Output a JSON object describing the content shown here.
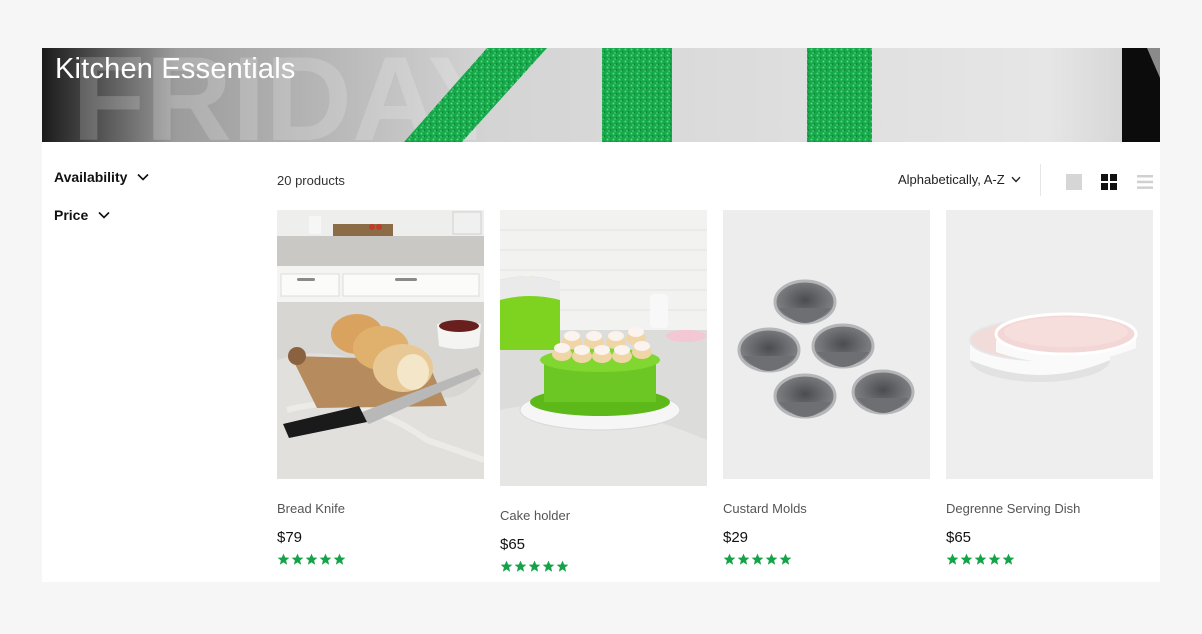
{
  "collection": {
    "title": "Kitchen Essentials",
    "product_count": "20 products"
  },
  "filters": [
    {
      "label": "Availability",
      "icon": "chevron-down-icon"
    },
    {
      "label": "Price",
      "icon": "chevron-down-icon"
    }
  ],
  "sort": {
    "value": "Alphabetically, A-Z",
    "icon": "chevron-down-icon"
  },
  "view_options": [
    {
      "name": "large-grid",
      "icon": "square-view-icon",
      "active": false
    },
    {
      "name": "grid",
      "icon": "grid-view-icon",
      "active": true
    },
    {
      "name": "list",
      "icon": "list-view-icon",
      "active": false
    }
  ],
  "colors": {
    "star": "#15a34a",
    "banner_green": "#17b34a"
  },
  "products": [
    {
      "title": "Bread Knife",
      "price": "$79",
      "rating": 5
    },
    {
      "title": "Cake holder",
      "price": "$65",
      "rating": 5
    },
    {
      "title": "Custard Molds",
      "price": "$29",
      "rating": 5
    },
    {
      "title": "Degrenne Serving Dish",
      "price": "$65",
      "rating": 5
    }
  ]
}
